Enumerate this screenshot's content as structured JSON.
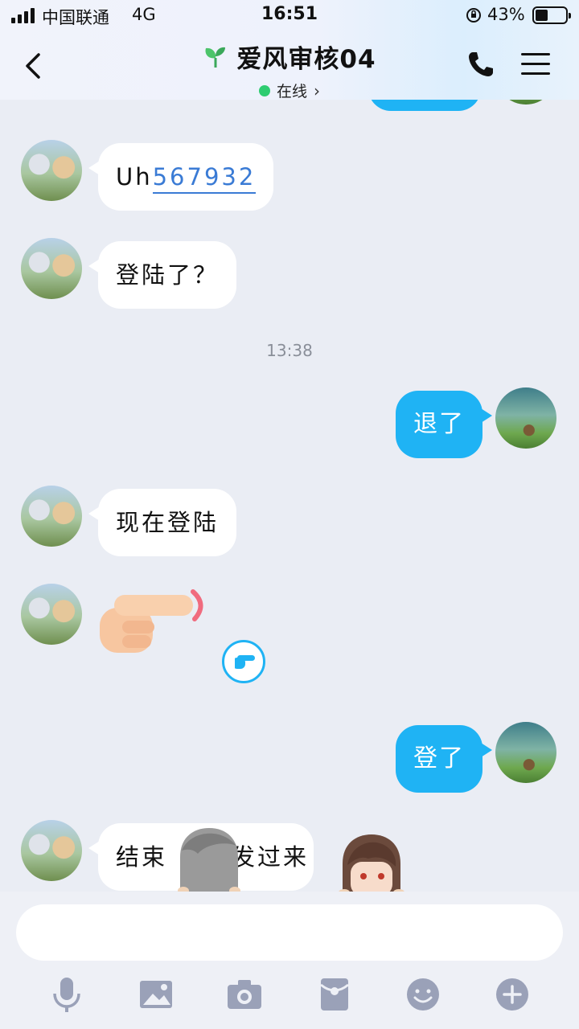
{
  "status": {
    "carrier": "中国联通",
    "network": "4G",
    "time": "16:51",
    "battery": "43%",
    "battery_level": 0.43
  },
  "header": {
    "title": "爱风审核04",
    "presence": "在线",
    "presence_color": "#2ecc71"
  },
  "messages": [
    {
      "side": "in",
      "prefix": "Uh",
      "link": "567932"
    },
    {
      "side": "in",
      "text": "登陆了？"
    },
    {
      "timestamp": "13:38"
    },
    {
      "side": "out",
      "text": "退了"
    },
    {
      "side": "in",
      "text": "现在登陆"
    },
    {
      "side": "in",
      "sticker": "pointing-finger"
    },
    {
      "side": "out",
      "text": "登了"
    },
    {
      "side": "in",
      "text_start": "结束",
      "text_end": "发过来"
    }
  ],
  "composer": {
    "value": "",
    "placeholder": ""
  },
  "toolbar": [
    "microphone-icon",
    "image-icon",
    "camera-icon",
    "red-packet-icon",
    "emoji-icon",
    "plus-icon"
  ],
  "colors": {
    "accent": "#1fb3f4",
    "incoming_bubble": "#ffffff",
    "background": "#eaedf4",
    "link": "#3a7bd5",
    "toolbar_icon": "#9aa1b8"
  }
}
